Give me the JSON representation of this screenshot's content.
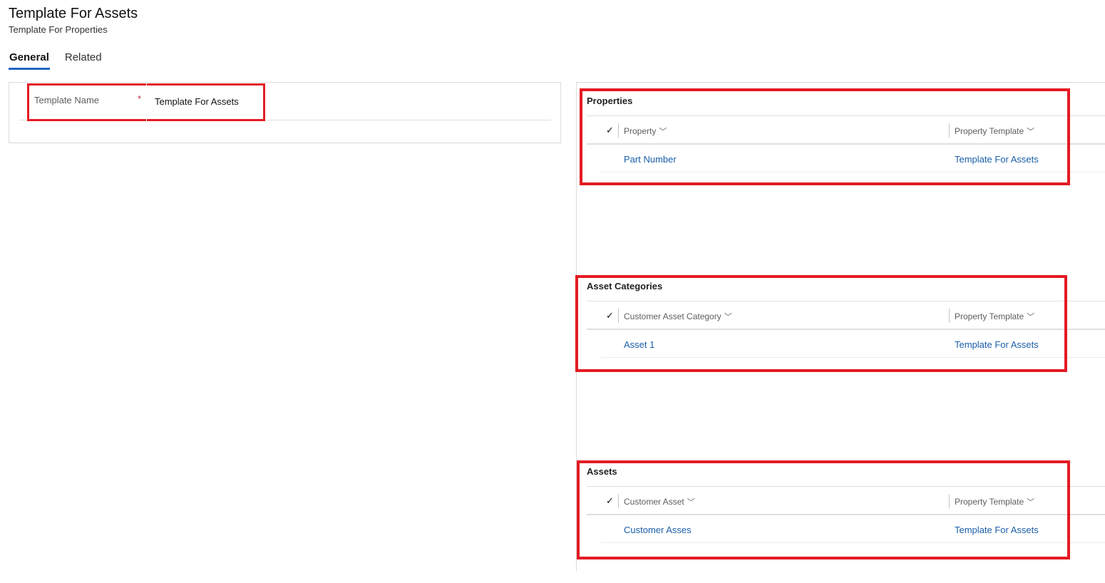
{
  "header": {
    "title": "Template For Assets",
    "subtitle": "Template For Properties"
  },
  "tabs": [
    {
      "label": "General",
      "active": true
    },
    {
      "label": "Related",
      "active": false
    }
  ],
  "form": {
    "field_label": "Template Name",
    "required_mark": "*",
    "field_value": "Template For Assets"
  },
  "sections": [
    {
      "title": "Properties",
      "columns": [
        "Property",
        "Property Template"
      ],
      "rows": [
        [
          "Part Number",
          "Template For Assets"
        ]
      ]
    },
    {
      "title": "Asset Categories",
      "columns": [
        "Customer Asset Category",
        "Property Template"
      ],
      "rows": [
        [
          "Asset 1",
          "Template For Assets"
        ]
      ]
    },
    {
      "title": "Assets",
      "columns": [
        "Customer Asset",
        "Property Template"
      ],
      "rows": [
        [
          "Customer Asses",
          "Template For Assets"
        ]
      ]
    }
  ],
  "icons": {
    "check": "checkmark-icon",
    "chevron": "chevron-down-icon"
  },
  "colors": {
    "highlight": "#e31b23",
    "link": "#1a5ea8",
    "tab_underline": "#2266c8"
  }
}
